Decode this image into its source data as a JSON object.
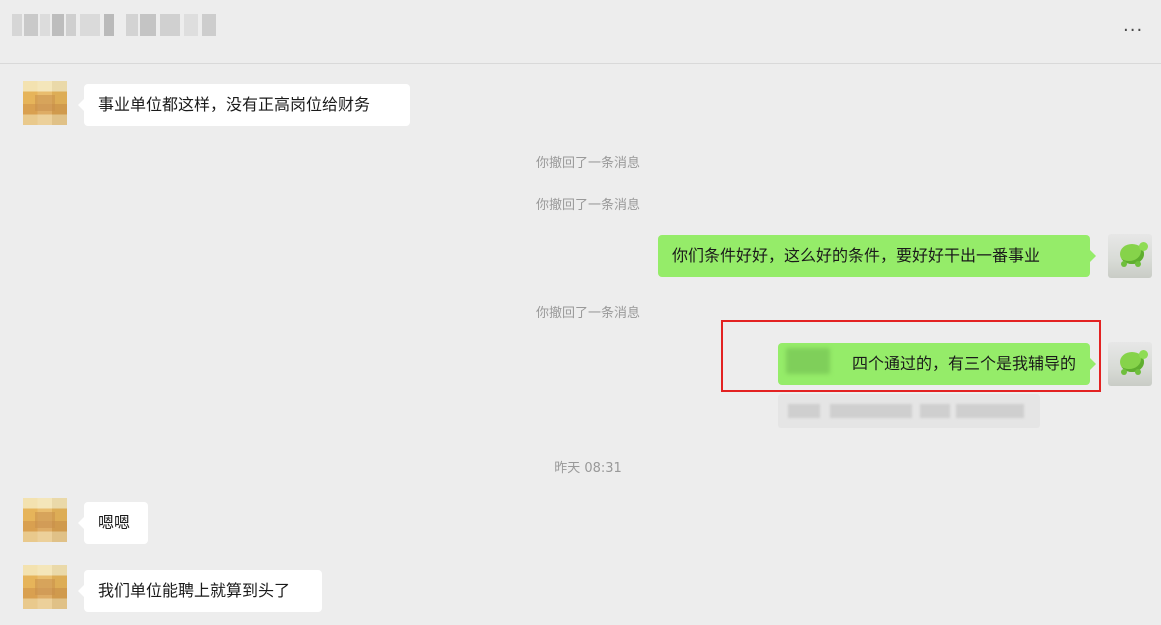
{
  "header": {
    "more_label": "···"
  },
  "messages": {
    "m1": "事业单位都这样，没有正高岗位给财务",
    "m2": "你们条件好好，这么好的条件，要好好干出一番事业",
    "m3": "四个通过的，有三个是我辅导的",
    "m4": "嗯嗯",
    "m5": "我们单位能聘上就算到头了"
  },
  "system": {
    "recall_1": "你撤回了一条消息",
    "recall_2": "你撤回了一条消息",
    "recall_3": "你撤回了一条消息",
    "time": "昨天 08:31"
  },
  "colors": {
    "background": "#ededed",
    "incoming_bubble": "#ffffff",
    "outgoing_bubble": "#95ec69",
    "highlight_border": "#e32222",
    "system_text": "#999999"
  }
}
